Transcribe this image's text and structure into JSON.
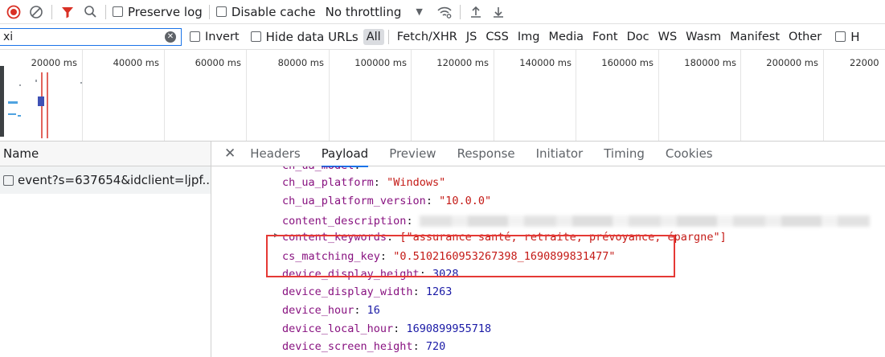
{
  "toolbar": {
    "record_icon": "record-stop-icon",
    "clear_icon": "clear-icon",
    "filter_icon": "filter-icon",
    "search_icon": "search-icon",
    "preserve_log": "Preserve log",
    "disable_cache": "Disable cache",
    "throttling": "No throttling",
    "wifi_icon": "network-conditions-icon",
    "import_icon": "upload-icon",
    "export_icon": "download-icon",
    "accent": "#d93025"
  },
  "filter": {
    "value": "xi",
    "invert": "Invert",
    "hide_data_urls": "Hide data URLs",
    "types": [
      "All",
      "Fetch/XHR",
      "JS",
      "CSS",
      "Img",
      "Media",
      "Font",
      "Doc",
      "WS",
      "Wasm",
      "Manifest",
      "Other"
    ],
    "active_type": "All",
    "trailing": "H"
  },
  "timeline": {
    "ticks": [
      "20000 ms",
      "40000 ms",
      "60000 ms",
      "80000 ms",
      "100000 ms",
      "120000 ms",
      "140000 ms",
      "160000 ms",
      "180000 ms",
      "200000 ms",
      "22000"
    ]
  },
  "requests": {
    "header": "Name",
    "rows": [
      "event?s=637654&idclient=ljpf..."
    ]
  },
  "details": {
    "tabs": [
      "Headers",
      "Payload",
      "Preview",
      "Response",
      "Initiator",
      "Timing",
      "Cookies"
    ],
    "active_tab": "Payload",
    "lines": [
      {
        "key": "ch_ua_model",
        "value": "",
        "kind": "str"
      },
      {
        "key": "ch_ua_platform",
        "value": "\"Windows\"",
        "kind": "str"
      },
      {
        "key": "ch_ua_platform_version",
        "value": "\"10.0.0\"",
        "kind": "str"
      },
      {
        "key": "content_description",
        "value": "",
        "kind": "redacted"
      },
      {
        "key": "content_keywords",
        "value": "[\"assurance santé, retraite, prévoyance, épargne\"]",
        "kind": "str"
      },
      {
        "key": "cs_matching_key",
        "value": "\"0.5102160953267398_1690899831477\"",
        "kind": "str"
      },
      {
        "key": "device_display_height",
        "value": "3028",
        "kind": "num"
      },
      {
        "key": "device_display_width",
        "value": "1263",
        "kind": "num"
      },
      {
        "key": "device_hour",
        "value": "16",
        "kind": "num"
      },
      {
        "key": "device_local_hour",
        "value": "1690899955718",
        "kind": "num"
      },
      {
        "key": "device_screen_height",
        "value": "720",
        "kind": "num"
      }
    ]
  }
}
